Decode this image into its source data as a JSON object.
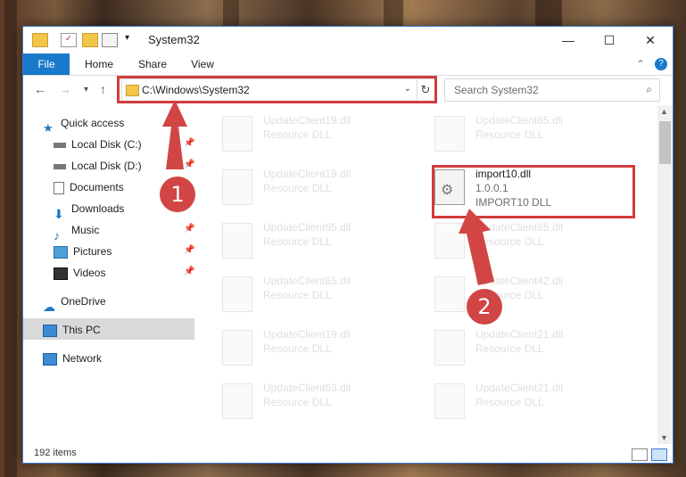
{
  "window": {
    "title": "System32"
  },
  "ribbon": {
    "tabs": [
      "File",
      "Home",
      "Share",
      "View"
    ]
  },
  "address": {
    "path": "C:\\Windows\\System32"
  },
  "search": {
    "placeholder": "Search System32"
  },
  "nav": [
    {
      "label": "Quick access"
    },
    {
      "label": "Local Disk (C:)"
    },
    {
      "label": "Local Disk (D:)"
    },
    {
      "label": "Documents"
    },
    {
      "label": "Downloads"
    },
    {
      "label": "Music"
    },
    {
      "label": "Pictures"
    },
    {
      "label": "Videos"
    },
    {
      "label": "OneDrive"
    },
    {
      "label": "This PC"
    },
    {
      "label": "Network"
    }
  ],
  "files": [
    {
      "name": "UpdateClient19.dll",
      "desc": "Resource DLL"
    },
    {
      "name": "UpdateClient65.dll",
      "desc": "Resource DLL"
    },
    {
      "name": "UpdateClient19.dll",
      "desc": "Resource DLL"
    },
    {
      "name": "import10.dll",
      "version": "1.0.0.1",
      "desc": "IMPORT10 DLL"
    },
    {
      "name": "UpdateClient65.dll",
      "desc": "Resource DLL"
    },
    {
      "name": "UpdateClient65.dll",
      "desc": "Resource DLL"
    },
    {
      "name": "UpdateClient65.dll",
      "desc": "Resource DLL"
    },
    {
      "name": "UpdateClient42.dll",
      "desc": "Resource DLL"
    },
    {
      "name": "UpdateClient19.dll",
      "desc": "Resource DLL"
    },
    {
      "name": "UpdateClient21.dll",
      "desc": "Resource DLL"
    },
    {
      "name": "UpdateClient63.dll",
      "desc": "Resource DLL"
    },
    {
      "name": "UpdateClient21.dll",
      "desc": "Resource DLL"
    }
  ],
  "status": {
    "items": "192 items"
  },
  "callouts": [
    "1",
    "2"
  ],
  "colors": {
    "accent": "#1979ca",
    "highlight": "#d13c3c"
  }
}
